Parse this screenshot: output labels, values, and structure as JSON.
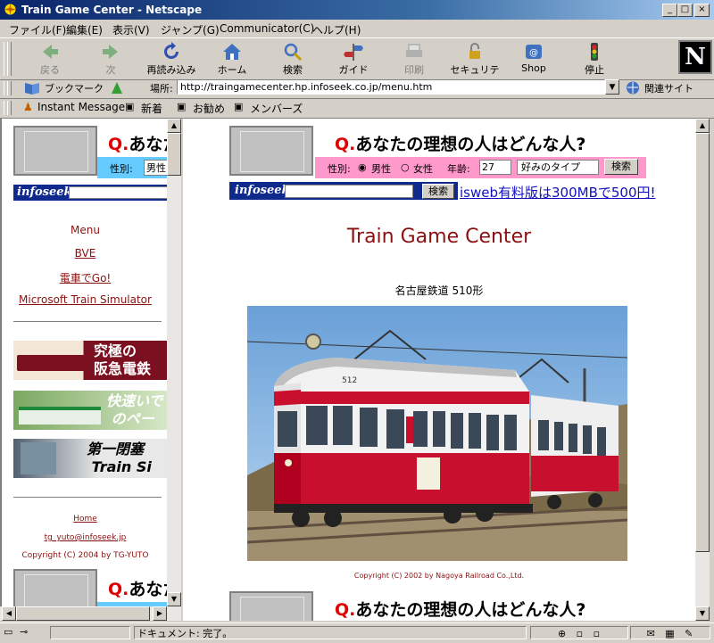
{
  "window": {
    "title": "Train Game Center - Netscape"
  },
  "menu": [
    "ファイル(F)",
    "編集(E)",
    "表示(V)",
    "ジャンプ(G)",
    "Communicator(C)",
    "ヘルプ(H)"
  ],
  "toolbar": [
    {
      "label": "戻る",
      "icon": "back-icon",
      "enabled": false
    },
    {
      "label": "次",
      "icon": "forward-icon",
      "enabled": false
    },
    {
      "label": "再読み込み",
      "icon": "reload-icon",
      "enabled": true
    },
    {
      "label": "ホーム",
      "icon": "home-icon",
      "enabled": true
    },
    {
      "label": "検索",
      "icon": "search-icon",
      "enabled": true
    },
    {
      "label": "ガイド",
      "icon": "guide-icon",
      "enabled": true
    },
    {
      "label": "印刷",
      "icon": "print-icon",
      "enabled": false
    },
    {
      "label": "セキュリティ",
      "icon": "security-icon",
      "enabled": true
    },
    {
      "label": "Shop",
      "icon": "shop-icon",
      "enabled": true
    },
    {
      "label": "停止",
      "icon": "stop-icon",
      "enabled": true
    }
  ],
  "location": {
    "bookmarks_label": "ブックマーク",
    "label": "場所:",
    "url": "http://traingamecenter.hp.infoseek.co.jp/menu.htm",
    "related_label": "関連サイト"
  },
  "personal": [
    "Instant Message",
    "新着",
    "お勧め",
    "メンバーズ"
  ],
  "ad": {
    "q": "Q.",
    "question": "あなたの理想の人はどんな人?",
    "gender_label": "性別:",
    "male": "男性",
    "female": "女性",
    "age_label": "年齢:",
    "age_value": "27",
    "type_select": "好みのタイプ",
    "search_button": "検索",
    "infoseek": "infoseek",
    "infoseek_search": "検索",
    "isweb": "isweb有料版は300MBで500円!"
  },
  "left_ad_left": {
    "q": "Q.",
    "text": "あなた",
    "gender_label": "性別:",
    "gender_value": "男性"
  },
  "left_nav": {
    "heading": "Menu",
    "links": [
      "BVE",
      "電車でGo!",
      "Microsoft Train Simulator"
    ],
    "banners": [
      {
        "text": "究極の阪急電鉄",
        "name": "hankyu-banner"
      },
      {
        "text": "快速いで...のペー",
        "name": "rapid-banner"
      },
      {
        "text": "第一閉塞 Train Si",
        "name": "block-banner"
      }
    ],
    "footer_home": "Home",
    "footer_email": "tg_yuto@infoseek.jp",
    "footer_copy": "Copyright (C) 2004 by TG-YUTO"
  },
  "main": {
    "title": "Train Game Center",
    "photo_caption": "名古屋鉄道 510形",
    "car_number": "512",
    "photo_copyright": "Copyright (C) 2002 by Nagoya Railroad Co.,Ltd."
  },
  "status": {
    "text": "ドキュメント: 完了。"
  },
  "colors": {
    "titlebar": "#0a246a",
    "link": "#8b1010",
    "question_mark": "#e00000",
    "form_pink": "#ff99cc",
    "infoseek_blue": "#0f2a8c"
  }
}
